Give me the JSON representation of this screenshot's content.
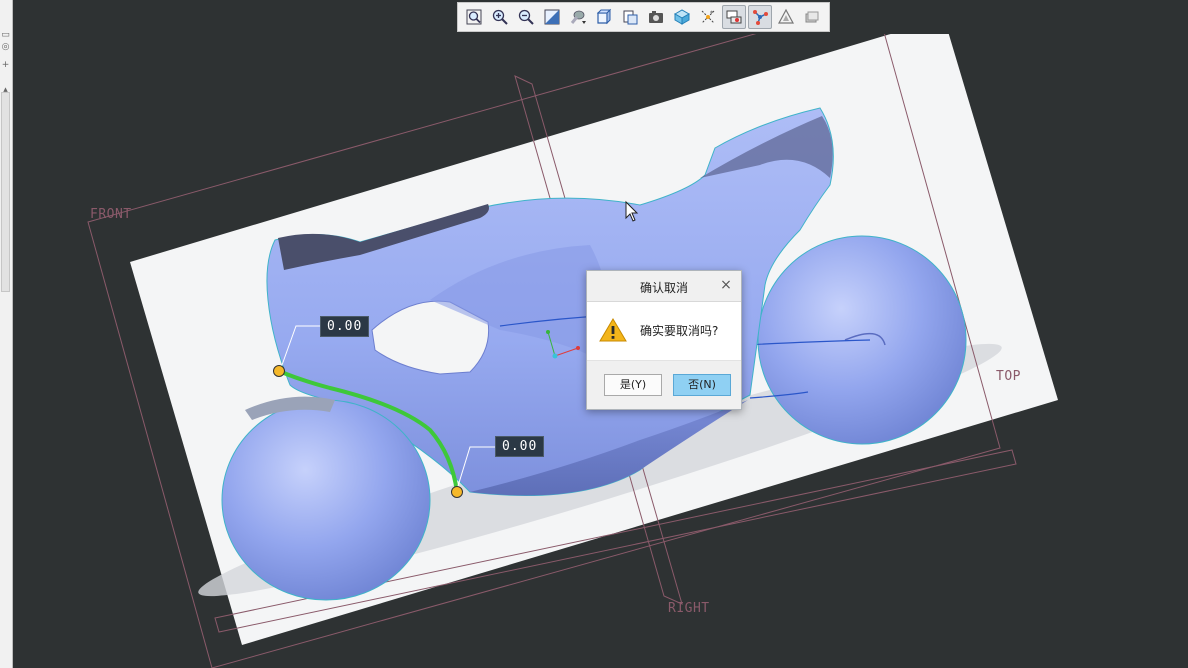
{
  "toolbar": {
    "buttons": [
      {
        "name": "refit-icon",
        "active": false
      },
      {
        "name": "zoom-in-icon",
        "active": false
      },
      {
        "name": "zoom-out-icon",
        "active": false
      },
      {
        "name": "repaint-icon",
        "active": false
      },
      {
        "name": "perspective-icon",
        "active": false
      },
      {
        "name": "display-style-icon",
        "active": false
      },
      {
        "name": "saved-orientations-icon",
        "active": false
      },
      {
        "name": "view-manager-icon",
        "active": false
      },
      {
        "name": "section-view-icon",
        "active": false
      },
      {
        "name": "datum-display-icon",
        "active": false
      },
      {
        "name": "annotation-display-icon",
        "active": true
      },
      {
        "name": "spin-center-icon",
        "active": true
      },
      {
        "name": "appearance-icon",
        "active": false
      },
      {
        "name": "layer-icon",
        "active": false
      }
    ]
  },
  "viewport": {
    "plane_labels": {
      "front": "FRONT",
      "right": "RIGHT",
      "top": "TOP"
    },
    "dimensions": {
      "dim1": "0.00",
      "dim2": "0.00"
    },
    "colors": {
      "background": "#2e3233",
      "body": "#93a7ee",
      "curve": "#3ec83a",
      "handle": "#f5b82a",
      "datum_plane": "#8a5a6a"
    }
  },
  "dialog": {
    "title": "确认取消",
    "close": "×",
    "message": "确实要取消吗?",
    "yes_label": "是(Y)",
    "no_label": "否(N)",
    "icon": "warning-icon"
  }
}
